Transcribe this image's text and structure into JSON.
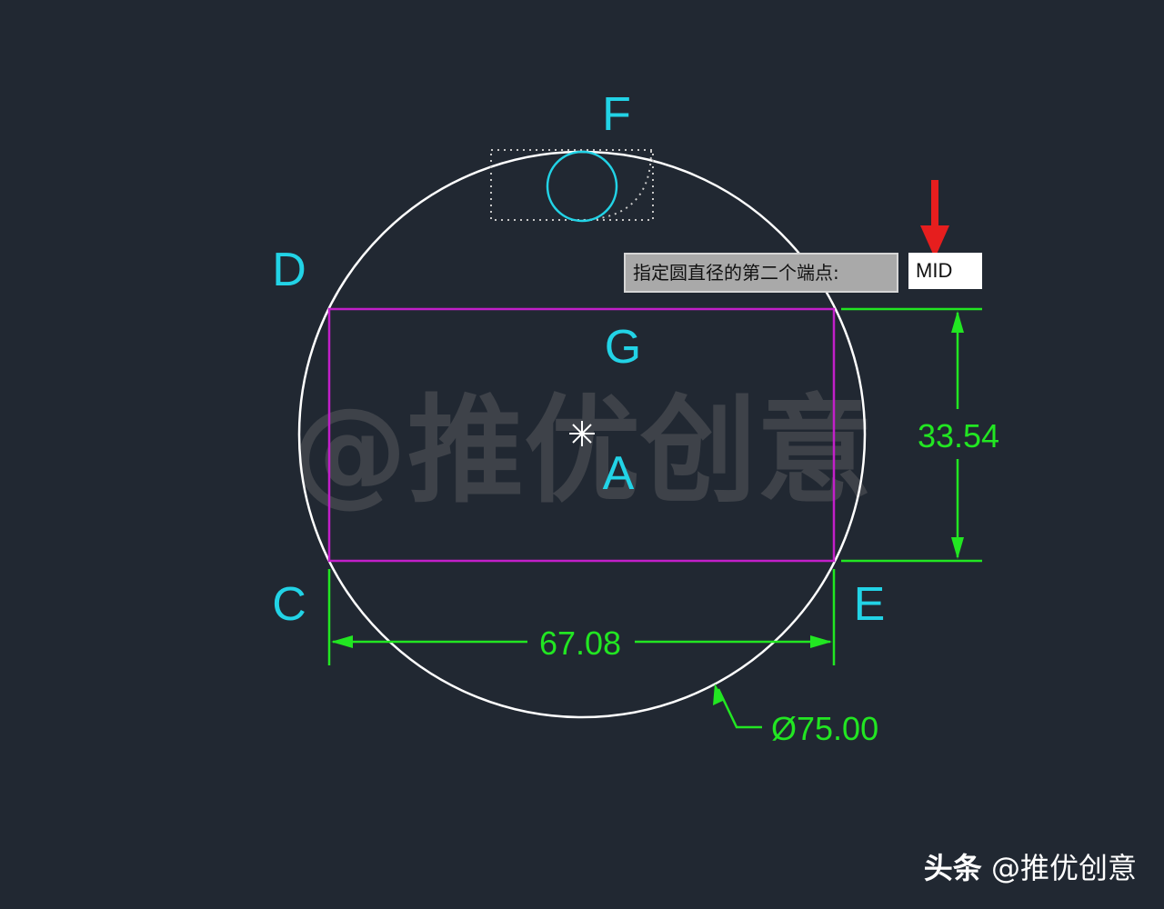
{
  "canvas": {
    "background": "#212832",
    "colors": {
      "outer_circle": "#ffffff",
      "rectangle": "#c21fc9",
      "letters": "#22d3e6",
      "dimensions": "#22e622",
      "arrow": "#e61e1e"
    }
  },
  "labels": {
    "F": "F",
    "D": "D",
    "G": "G",
    "A": "A",
    "C": "C",
    "E": "E"
  },
  "dimensions": {
    "height": "33.54",
    "width": "67.08",
    "diameter": "Ø75.00"
  },
  "watermark": {
    "center_text": "@推优创意"
  },
  "command": {
    "prompt": "指定圆直径的第二个端点:",
    "input_value": "MID"
  },
  "footer": {
    "brand": "头条",
    "handle": "@推优创意"
  },
  "icons": {
    "center_marker": "asterisk-snap-icon",
    "pointer": "red-arrow-icon"
  }
}
